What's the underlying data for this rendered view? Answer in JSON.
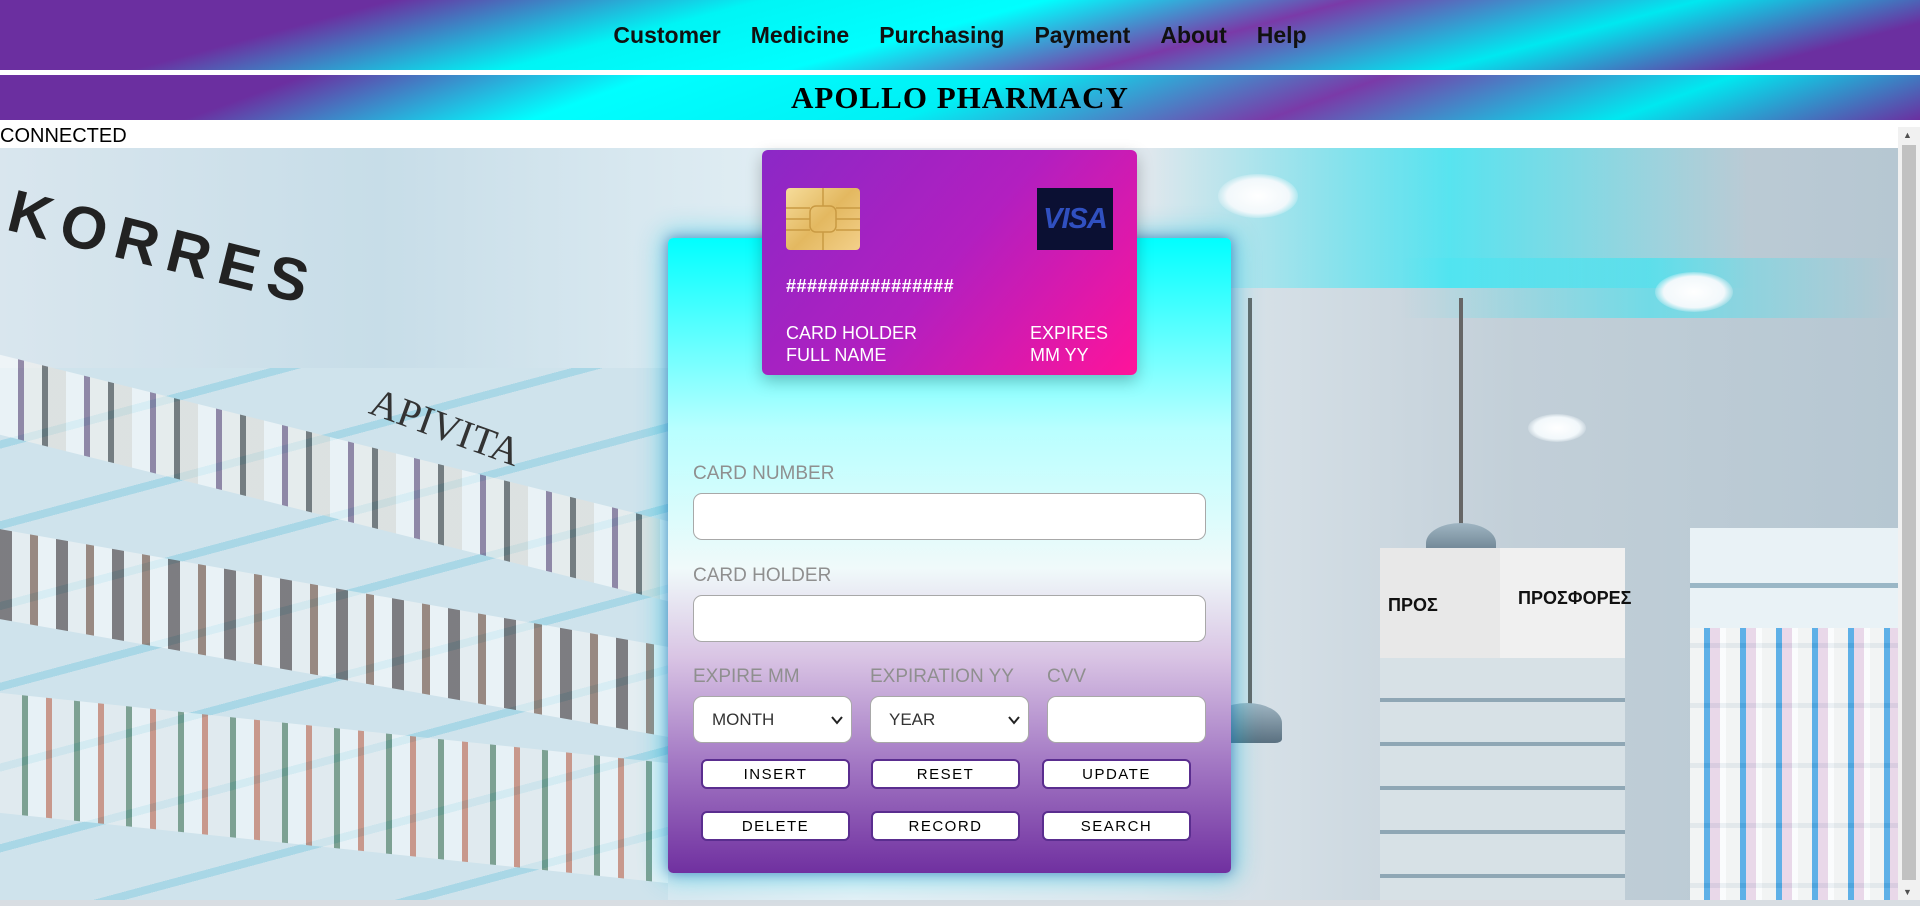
{
  "nav": {
    "items": [
      "Customer",
      "Medicine",
      "Purchasing",
      "Payment",
      "About",
      "Help"
    ]
  },
  "header": {
    "title": "APOLLO PHARMACY"
  },
  "status": {
    "text": "CONNECTED"
  },
  "background": {
    "brand_text": "KORRES",
    "brand_text_2": "APIVITA",
    "sign_1": "ΠΡΟΣΦΟΡΕΣ",
    "sign_2": "ΠΡΟΣ"
  },
  "card": {
    "number": "################",
    "holder_label": "CARD HOLDER",
    "holder_value": "FULL NAME",
    "expires_label": "EXPIRES",
    "expires_value": "MM YY",
    "brand": "VISA"
  },
  "form": {
    "card_number_label": "CARD NUMBER",
    "card_number_value": "",
    "card_holder_label": "CARD HOLDER",
    "card_holder_value": "",
    "expire_mm_label": "EXPIRE MM",
    "expire_mm_value": "MONTH",
    "expire_yy_label": "EXPIRATION YY",
    "expire_yy_value": "YEAR",
    "cvv_label": "CVV",
    "cvv_value": ""
  },
  "buttons": {
    "insert": "INSERT",
    "reset": "RESET",
    "update": "UPDATE",
    "delete": "DELETE",
    "record": "RECORD",
    "search": "SEARCH"
  },
  "colors": {
    "nav_purple": "#6b2fa0",
    "nav_cyan": "#00ffff",
    "card_start": "#8b28c6",
    "card_end": "#ff139a",
    "button_border": "#5a2d8f"
  }
}
